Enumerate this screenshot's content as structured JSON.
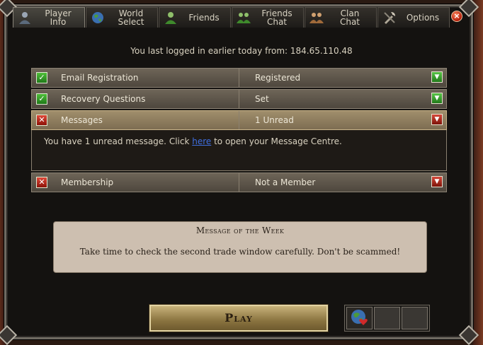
{
  "tabs": [
    {
      "label": "Player\nInfo",
      "icon": "player-icon",
      "active": true
    },
    {
      "label": "World\nSelect",
      "icon": "globe-icon",
      "active": false
    },
    {
      "label": "Friends",
      "icon": "friend-icon",
      "active": false
    },
    {
      "label": "Friends\nChat",
      "icon": "friends-chat-icon",
      "active": false
    },
    {
      "label": "Clan\nChat",
      "icon": "clan-icon",
      "active": false
    },
    {
      "label": "Options",
      "icon": "tools-icon",
      "active": false
    }
  ],
  "login_info": "You last logged in earlier today from: 184.65.110.48",
  "rows": [
    {
      "label": "Email Registration",
      "value": "Registered",
      "status": "ok"
    },
    {
      "label": "Recovery Questions",
      "value": "Set",
      "status": "ok"
    },
    {
      "label": "Messages",
      "value": "1 Unread",
      "status": "bad"
    },
    {
      "label": "Membership",
      "value": "Not a Member",
      "status": "bad"
    }
  ],
  "messages_panel": {
    "prefix": "You have 1 unread message. Click ",
    "link": "here",
    "suffix": " to open your Message Centre."
  },
  "motw": {
    "title": "Message of the Week",
    "body": "Take time to check the second trade window carefully.  Don't be scammed!"
  },
  "play_label": "Play",
  "colors": {
    "ok": "#2f9a28",
    "bad": "#b3281a",
    "panel": "#cdbfb0"
  }
}
